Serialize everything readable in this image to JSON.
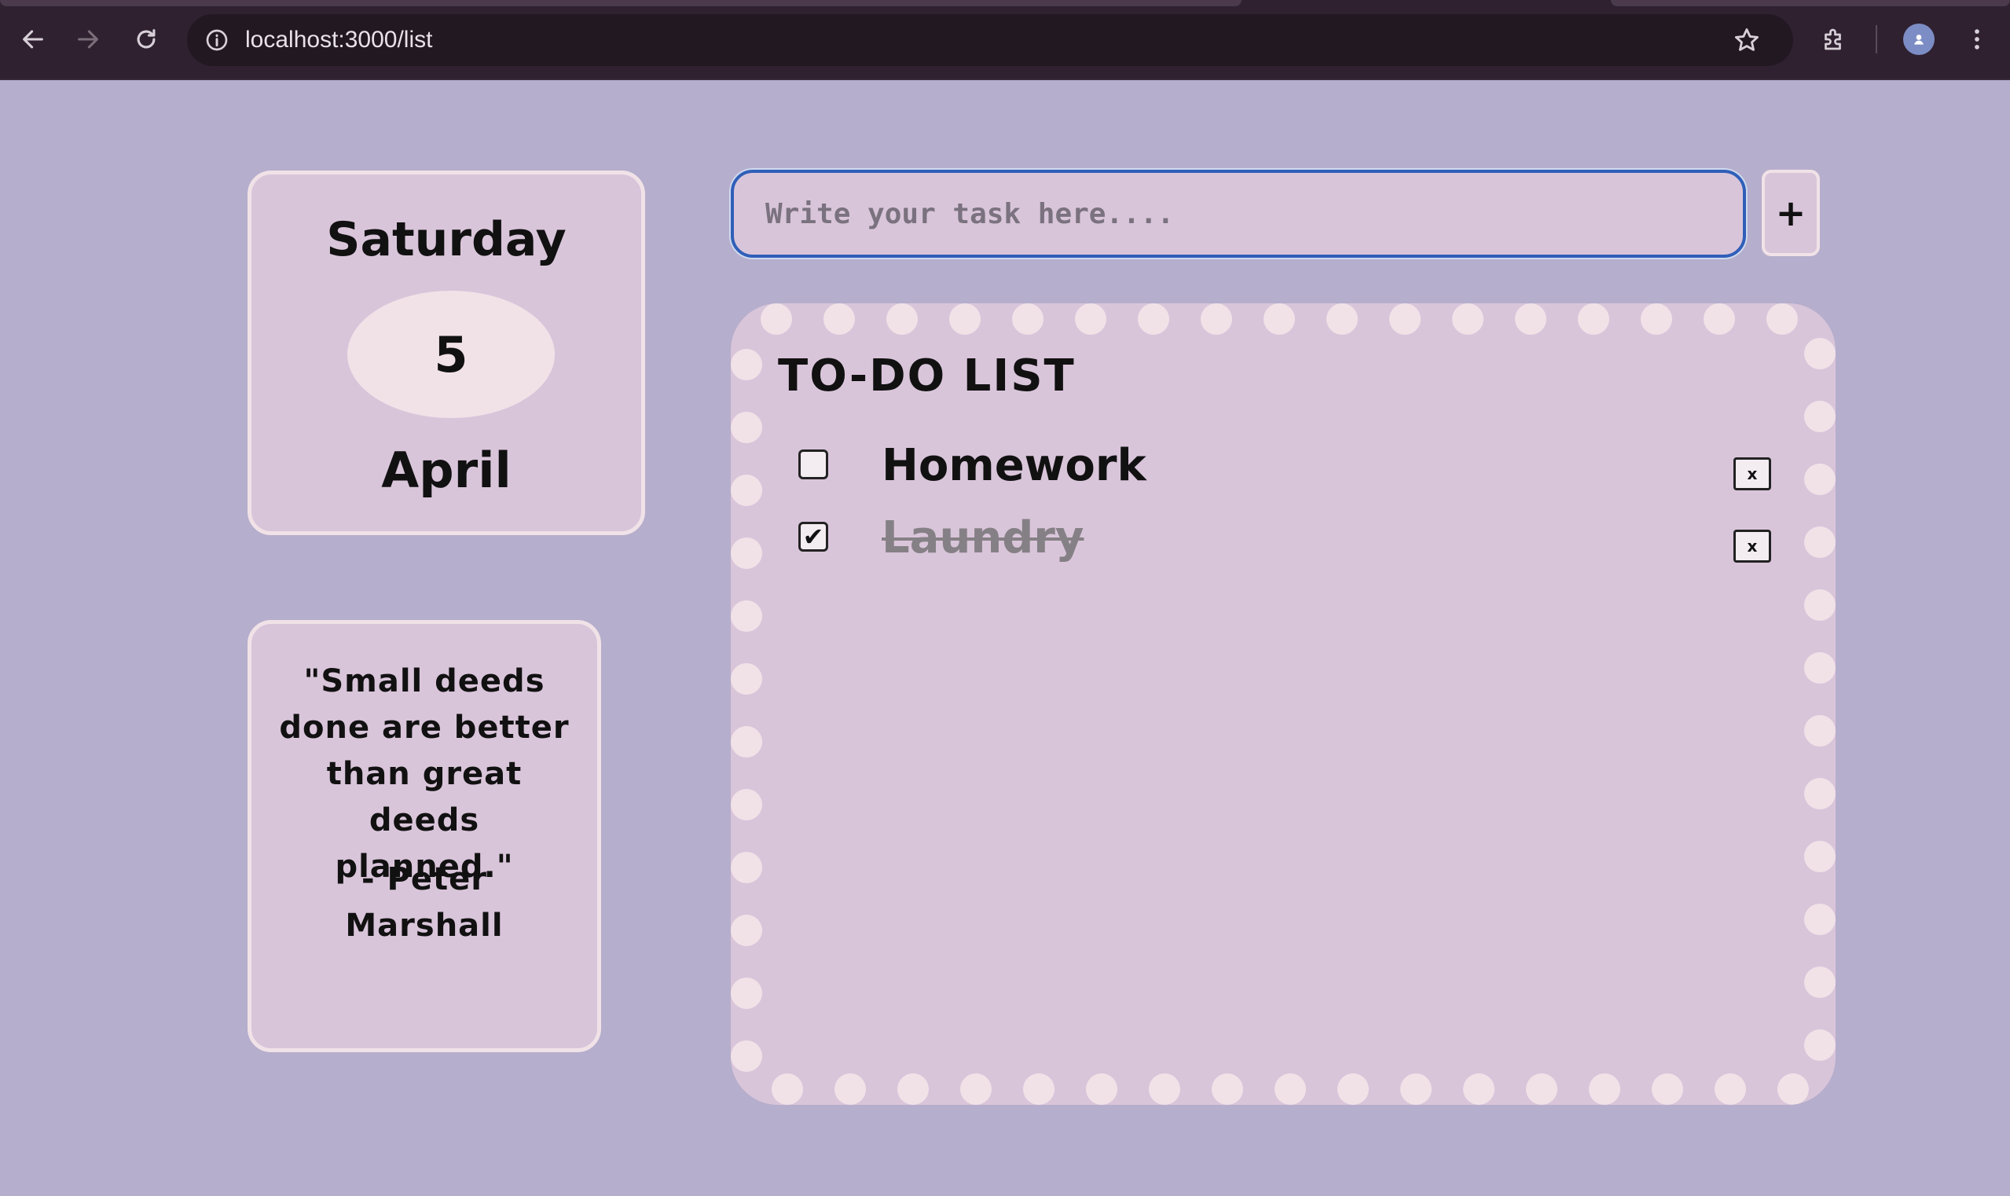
{
  "browser": {
    "url": "localhost:3000/list",
    "icons": {
      "back": "arrow-left-icon",
      "forward": "arrow-right-icon",
      "reload": "reload-icon",
      "site_info": "info-icon",
      "bookmark": "star-icon",
      "extensions": "puzzle-icon",
      "menu": "kebab-menu-icon"
    }
  },
  "date_card": {
    "day_name": "Saturday",
    "day_number": "5",
    "month": "April"
  },
  "quote": {
    "text": "\"Small deeds done are better than great deeds planned.\"",
    "author": "- Peter Marshall"
  },
  "task_form": {
    "placeholder": "Write your task here....",
    "add_label": "+"
  },
  "todo": {
    "title": "TO-DO LIST",
    "tasks": [
      {
        "label": "Homework",
        "checked": false,
        "delete_label": "x"
      },
      {
        "label": "Laundry",
        "checked": true,
        "check_mark": "✔",
        "delete_label": "x"
      }
    ]
  },
  "colors": {
    "page_bg": "#b5aecc",
    "card_bg": "#d9c5da",
    "card_border": "#f1e2e8",
    "focus_ring": "#2f5fb8",
    "chrome_bg": "#2f2130"
  }
}
